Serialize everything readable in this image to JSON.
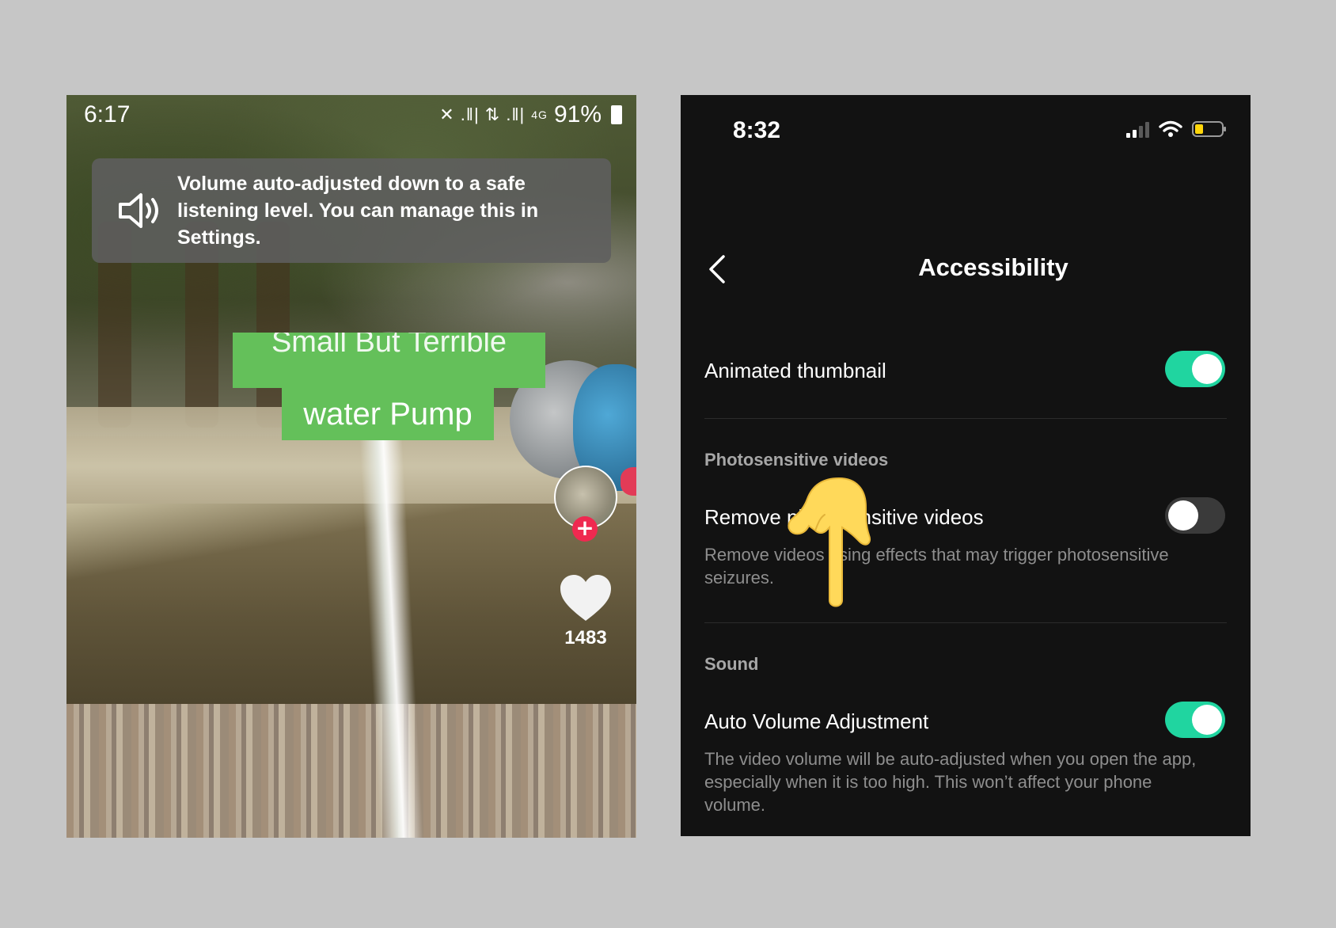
{
  "left_screen": {
    "status_bar": {
      "time": "6:17",
      "signal_glyphs": "✕ .‖| ⇅ .‖|",
      "network": "4G",
      "battery": "91%"
    },
    "toast": {
      "icon": "speaker-icon",
      "message": "Volume auto-adjusted down to a safe listening level. You can manage this in Settings."
    },
    "video_caption": {
      "line1": "Small But Terrible",
      "line2": "water Pump"
    },
    "side_rail": {
      "follow_symbol": "+",
      "like_count": "1483"
    }
  },
  "right_screen": {
    "status_bar": {
      "time": "8:32",
      "battery_color": "#ffd60a"
    },
    "nav": {
      "title": "Accessibility",
      "back_icon": "chevron-left-icon"
    },
    "rows": {
      "animated_thumbnail": {
        "label": "Animated thumbnail",
        "enabled": true
      },
      "photosensitive_section": "Photosensitive videos",
      "remove_photosensitive": {
        "label": "Remove photosensitive videos",
        "description": "Remove videos using effects that may trigger photosensitive seizures.",
        "enabled": false
      },
      "sound_section": "Sound",
      "auto_volume": {
        "label": "Auto Volume Adjustment",
        "description": "The video volume will be auto-adjusted when you open the app, especially when it is too high. This won’t affect your phone volume.",
        "enabled": true
      }
    },
    "colors": {
      "toggle_on": "#20d5a0",
      "toggle_off": "#3a3a3a",
      "background": "#121212"
    }
  }
}
